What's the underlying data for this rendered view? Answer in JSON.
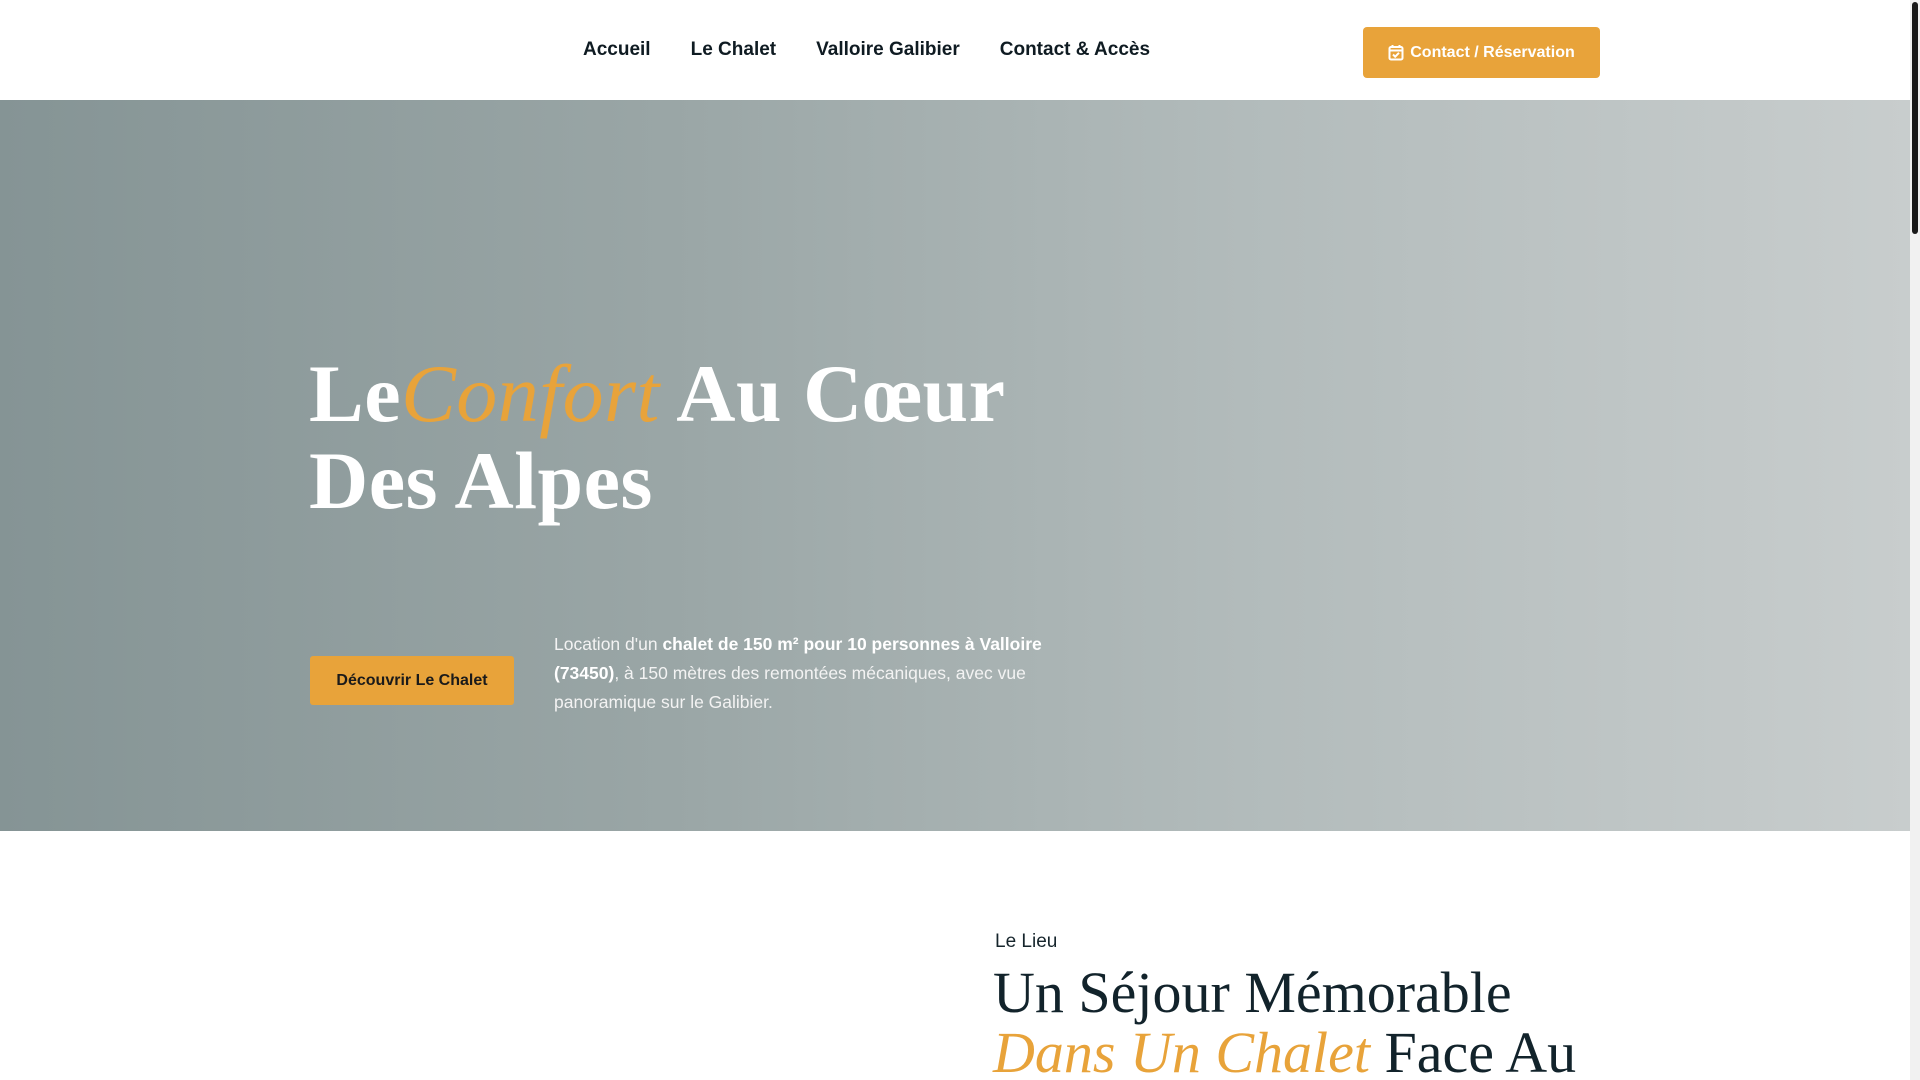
{
  "nav": {
    "items": [
      {
        "label": "Accueil"
      },
      {
        "label": "Le Chalet"
      },
      {
        "label": "Valloire Galibier"
      },
      {
        "label": "Contact & Accès"
      }
    ],
    "cta_label": "Contact / Réservation",
    "cta_icon": "calendar-check-icon"
  },
  "hero": {
    "title_part1": "Le",
    "title_accent": "Confort",
    "title_part2": " Au Cœur Des Alpes",
    "button_label": "Découvrir Le Chalet",
    "desc_part1": "Location d'un ",
    "desc_bold": "chalet de 150 m² pour 10 personnes à Valloire (73450)",
    "desc_part2": ", à 150 mètres des remontées mécaniques, avec vue panoramique sur le Galibier."
  },
  "lieu": {
    "eyebrow": "Le Lieu",
    "title_line1": "Un Séjour Mémorable",
    "title_accent": "Dans Un Chalet",
    "title_rest": " Face Au"
  },
  "colors": {
    "accent": "#e8a33a",
    "dark_text": "#12232b",
    "hero_gradient_start": "#859495",
    "hero_gradient_end": "#c8cdcd"
  }
}
